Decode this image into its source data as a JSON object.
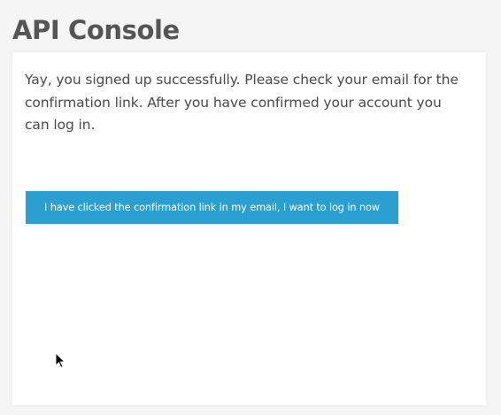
{
  "page": {
    "title": "API Console"
  },
  "signup_card": {
    "message": "Yay, you signed up successfully. Please check your email for the confirmation link. After you have confirmed your account you can log in.",
    "confirm_button_label": "I have clicked the confirmation link in my email, I want to log in now"
  },
  "colors": {
    "button_background": "#2a9fd0",
    "button_text": "#ffffff",
    "title_text": "#555555",
    "body_text": "#4a4a4a",
    "page_background": "#f5f5f5",
    "card_background": "#ffffff"
  },
  "icons": {
    "cursor": "mouse-pointer-icon"
  }
}
